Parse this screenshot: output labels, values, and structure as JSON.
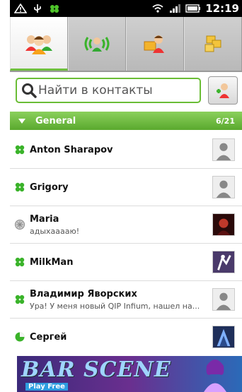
{
  "statusbar": {
    "time": "12:19"
  },
  "tabs": [
    {
      "icon": "contacts-icon",
      "active": true
    },
    {
      "icon": "online-icon",
      "active": false
    },
    {
      "icon": "chat-icon",
      "active": false
    },
    {
      "icon": "history-icon",
      "active": false
    }
  ],
  "search": {
    "placeholder": "Найти в контакты"
  },
  "group": {
    "name": "General",
    "count": "6/21"
  },
  "contacts": [
    {
      "name": "Anton Sharapov",
      "message": "",
      "status": "online"
    },
    {
      "name": "Grigory",
      "message": "",
      "status": "online"
    },
    {
      "name": "Maria",
      "message": "адыхааааю!",
      "status": "offline"
    },
    {
      "name": "MilkMan",
      "message": "",
      "status": "online"
    },
    {
      "name": "Владимир Яворских",
      "message": "Ура! У меня новый QIP Infium, нашел на...",
      "status": "online"
    },
    {
      "name": "Сергей",
      "message": "",
      "status": "away"
    }
  ],
  "banner": {
    "title": "BAR SCENE",
    "subtitle": "Play Free"
  },
  "colors": {
    "accent": "#6abd35",
    "header": "#5aa92e"
  }
}
